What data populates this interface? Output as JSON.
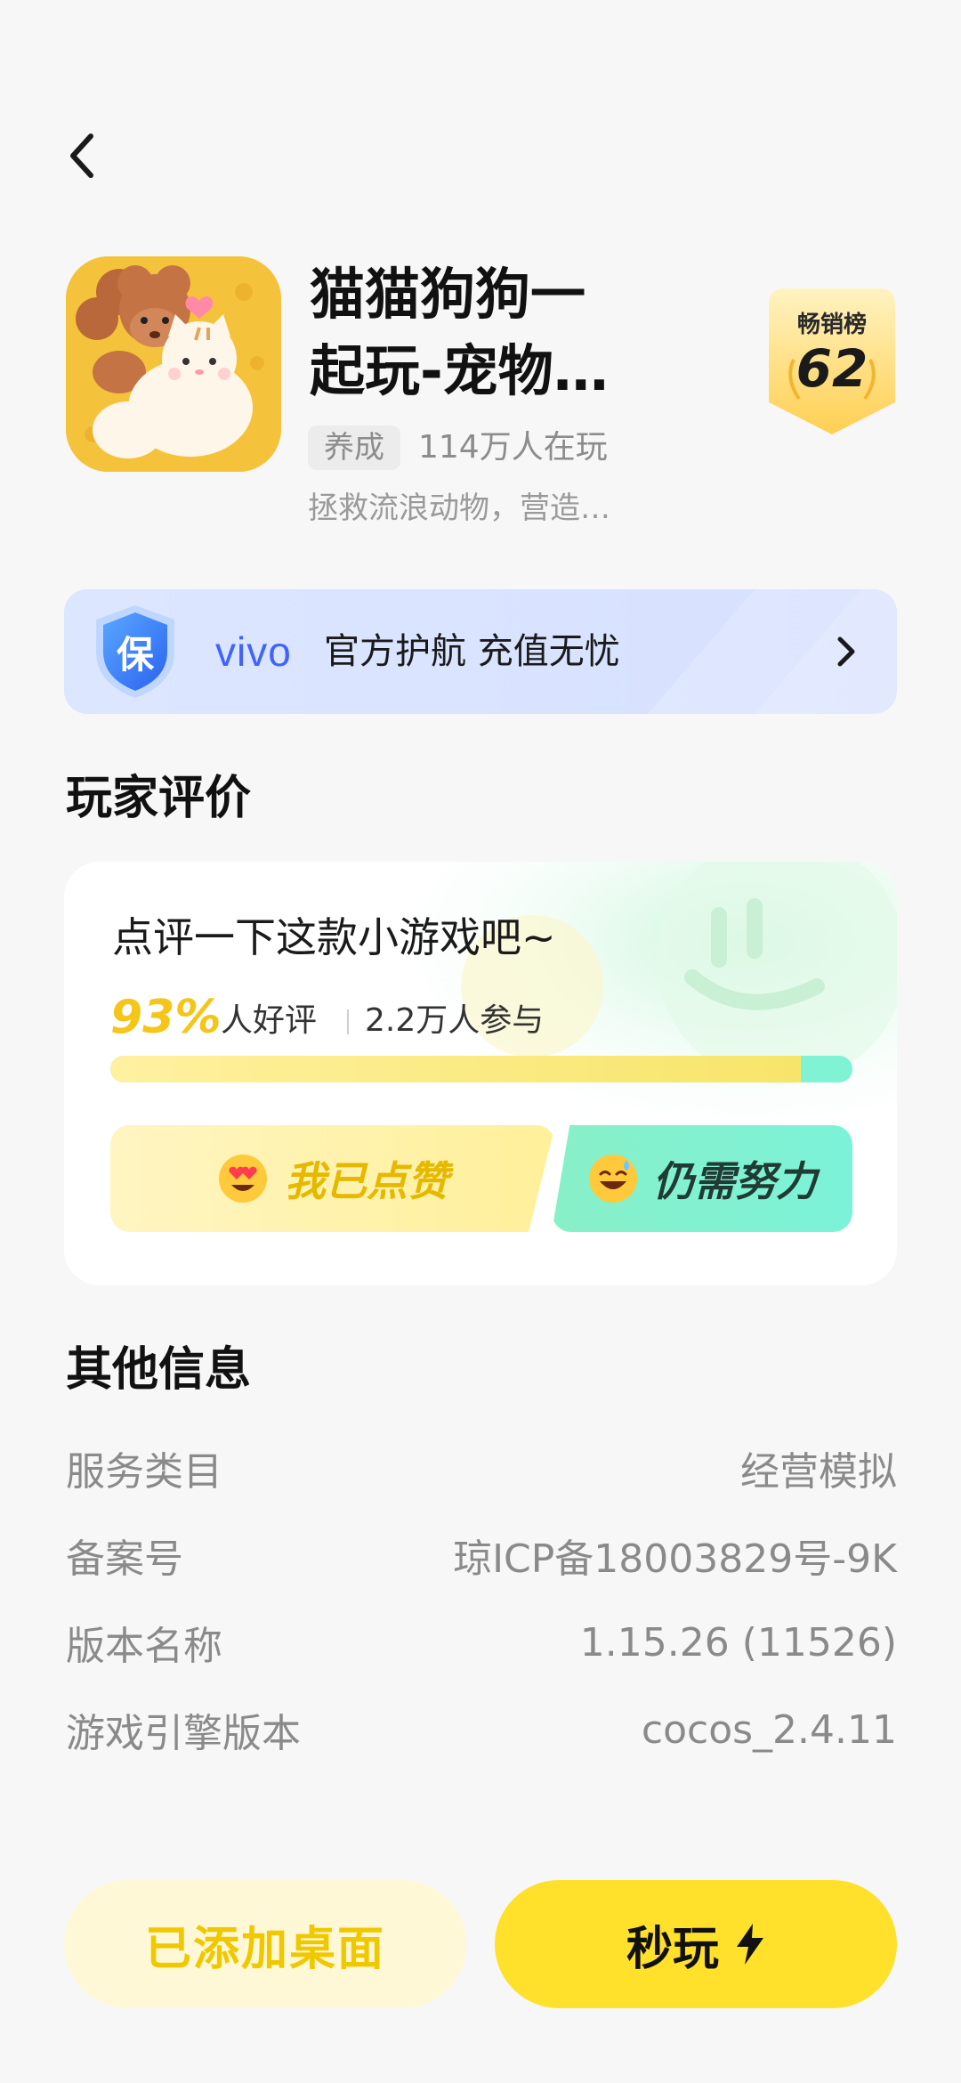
{
  "header": {
    "back_icon": "chevron-left-icon"
  },
  "app": {
    "title_line1": "猫猫狗狗一",
    "title_line2": "起玩-宠物…",
    "tag": "养成",
    "players": "114万人在玩",
    "description": "拯救流浪动物，营造…",
    "icon_colors": {
      "background": "#f5c33b"
    }
  },
  "rank": {
    "label": "畅销榜",
    "value": "62"
  },
  "banner": {
    "brand": "vivo",
    "text": "官方护航 充值无忧",
    "shield_char": "保",
    "accent": "#3e63ff"
  },
  "reviews": {
    "section_title": "玩家评价",
    "prompt": "点评一下这款小游戏吧~",
    "percent": "93%",
    "percent_value": 0.93,
    "good_label": "人好评",
    "count_label": "2.2万人参与",
    "like_label": "我已点赞",
    "dislike_label": "仍需努力"
  },
  "info": {
    "section_title": "其他信息",
    "rows": [
      {
        "label": "服务类目",
        "value": "经营模拟"
      },
      {
        "label": "备案号",
        "value": "琼ICP备18003829号-9K"
      },
      {
        "label": "版本名称",
        "value": "1.15.26 (11526)"
      },
      {
        "label": "游戏引擎版本",
        "value": "cocos_2.4.11"
      }
    ]
  },
  "actions": {
    "add_desktop": "已添加桌面",
    "play_now": "秒玩",
    "play_icon": "lightning-icon"
  }
}
